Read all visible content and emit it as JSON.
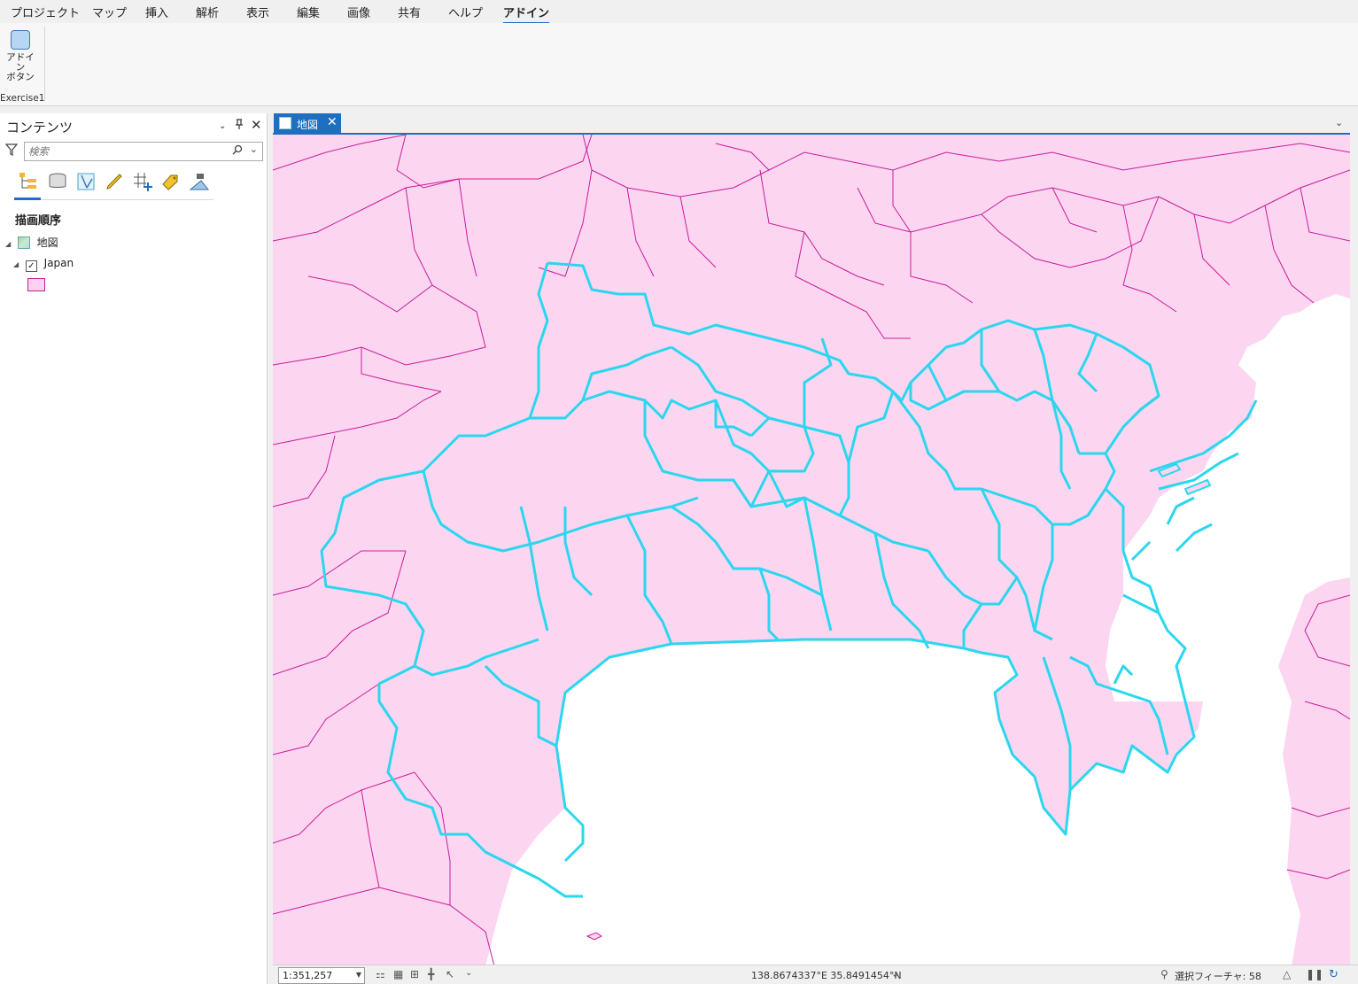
{
  "ribbon": {
    "tabs": [
      "プロジェクト",
      "マップ",
      "挿入",
      "解析",
      "表示",
      "編集",
      "画像",
      "共有",
      "ヘルプ",
      "アドイン"
    ],
    "active_tab": "アドイン",
    "addin_button_line1": "アドイン",
    "addin_button_line2": "ボタン",
    "group_label": "Exercise1"
  },
  "contents": {
    "title": "コンテンツ",
    "search_placeholder": "検索",
    "section_title": "描画順序",
    "map_node": "地図",
    "layer_name": "Japan",
    "layer_checked": true,
    "symbol_fill": "#f9d3ef",
    "symbol_outline": "#c81d9a",
    "tools": [
      "list-by-drawing-order-icon",
      "list-by-source-icon",
      "list-by-selection-icon",
      "list-by-editing-icon",
      "list-by-snapping-icon",
      "list-by-labeling-icon",
      "list-by-perspective-imagery-icon"
    ]
  },
  "map_view": {
    "tab_label": "地図",
    "land_fill": "#fcd6f0",
    "boundary_color": "#c81d9a",
    "selected_outline_color": "#2ad7ef",
    "water_color": "#ffffff"
  },
  "status": {
    "scale": "1:351,257",
    "coordinates": "138.8674337°E 35.8491454°N",
    "selected_features": "選択フィーチャ: 58"
  }
}
